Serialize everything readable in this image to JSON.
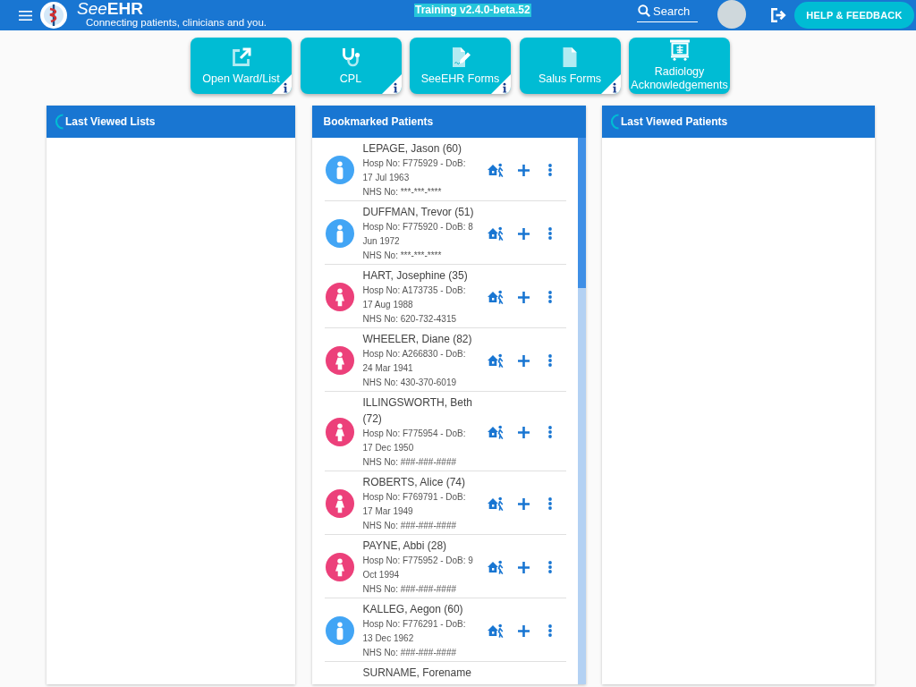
{
  "header": {
    "brand": "See**EHR**",
    "tagline": "Connecting patients, clinicians and you.",
    "environment_badge": "Training v2.4.0-beta.52",
    "search": {
      "placeholder": "Search"
    },
    "help_button": "HELP & FEEDBACK"
  },
  "tiles": [
    {
      "label": "Open Ward/List",
      "info": true
    },
    {
      "label": "CPL",
      "info": true
    },
    {
      "label": "SeeEHR Forms",
      "info": true
    },
    {
      "label": "Salus Forms",
      "info": true
    },
    {
      "label": "Radiology Acknowledgements",
      "info": false
    }
  ],
  "panels": [
    {
      "title": "Last Viewed Lists",
      "loading": true
    },
    {
      "title": "Bookmarked Patients",
      "loading": false,
      "rows": [
        {
          "kind": "male",
          "name": "LEPAGE, Jason (60)",
          "details": "Hosp No: F775929 - DoB: 17 Jul 1963",
          "nhs": "NHS No: ***-***-****"
        },
        {
          "kind": "male",
          "name": "DUFFMAN, Trevor (51)",
          "details": "Hosp No: F775920 - DoB: 8 Jun 1972",
          "nhs": "NHS No: ***-***-****"
        },
        {
          "kind": "female",
          "name": "HART, Josephine (35)",
          "details": "Hosp No: A173735 - DoB: 17 Aug 1988",
          "nhs": "NHS No: 620-732-4315"
        },
        {
          "kind": "female",
          "name": "WHEELER, Diane (82)",
          "details": "Hosp No: A266830 - DoB: 24 Mar 1941",
          "nhs": "NHS No: 430-370-6019"
        },
        {
          "kind": "female",
          "name": "ILLINGSWORTH, Beth (72)",
          "details": "Hosp No: F775954 - DoB: 17 Dec 1950",
          "nhs": "NHS No: ###-###-####"
        },
        {
          "kind": "female",
          "name": "ROBERTS, Alice (74)",
          "details": "Hosp No: F769791 - DoB: 17 Mar 1949",
          "nhs": "NHS No: ###-###-####"
        },
        {
          "kind": "female",
          "name": "PAYNE, Abbi (28)",
          "details": "Hosp No: F775952 - DoB: 9 Oct 1994",
          "nhs": "NHS No: ###-###-####"
        },
        {
          "kind": "male",
          "name": "KALLEG, Aegon (60)",
          "details": "Hosp No: F776291 - DoB: 13 Dec 1962",
          "nhs": "NHS No: ###-###-####"
        },
        {
          "kind": "partial",
          "name": "SURNAME, Forename"
        }
      ]
    },
    {
      "title": "Last Viewed Patients",
      "loading": true
    }
  ]
}
